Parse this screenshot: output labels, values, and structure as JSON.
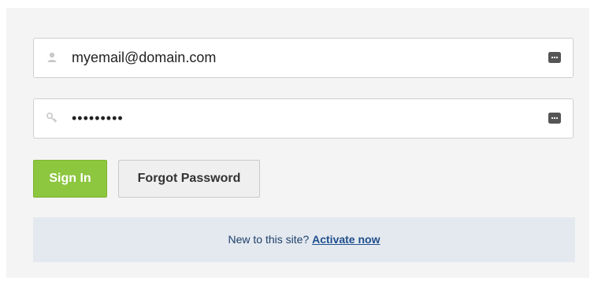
{
  "login": {
    "email_value": "myemail@domain.com",
    "password_value": "•••••••••",
    "email_icon": "user-icon",
    "password_icon": "key-icon",
    "autofill_icon": "keychain-icon"
  },
  "actions": {
    "signin_label": "Sign In",
    "forgot_label": "Forgot Password"
  },
  "footer": {
    "prompt_text": "New to this site?",
    "activate_label": "Activate now"
  },
  "colors": {
    "primary_button": "#8dc63f",
    "link": "#1f4e8c",
    "footer_bg": "#e3e9ef"
  }
}
